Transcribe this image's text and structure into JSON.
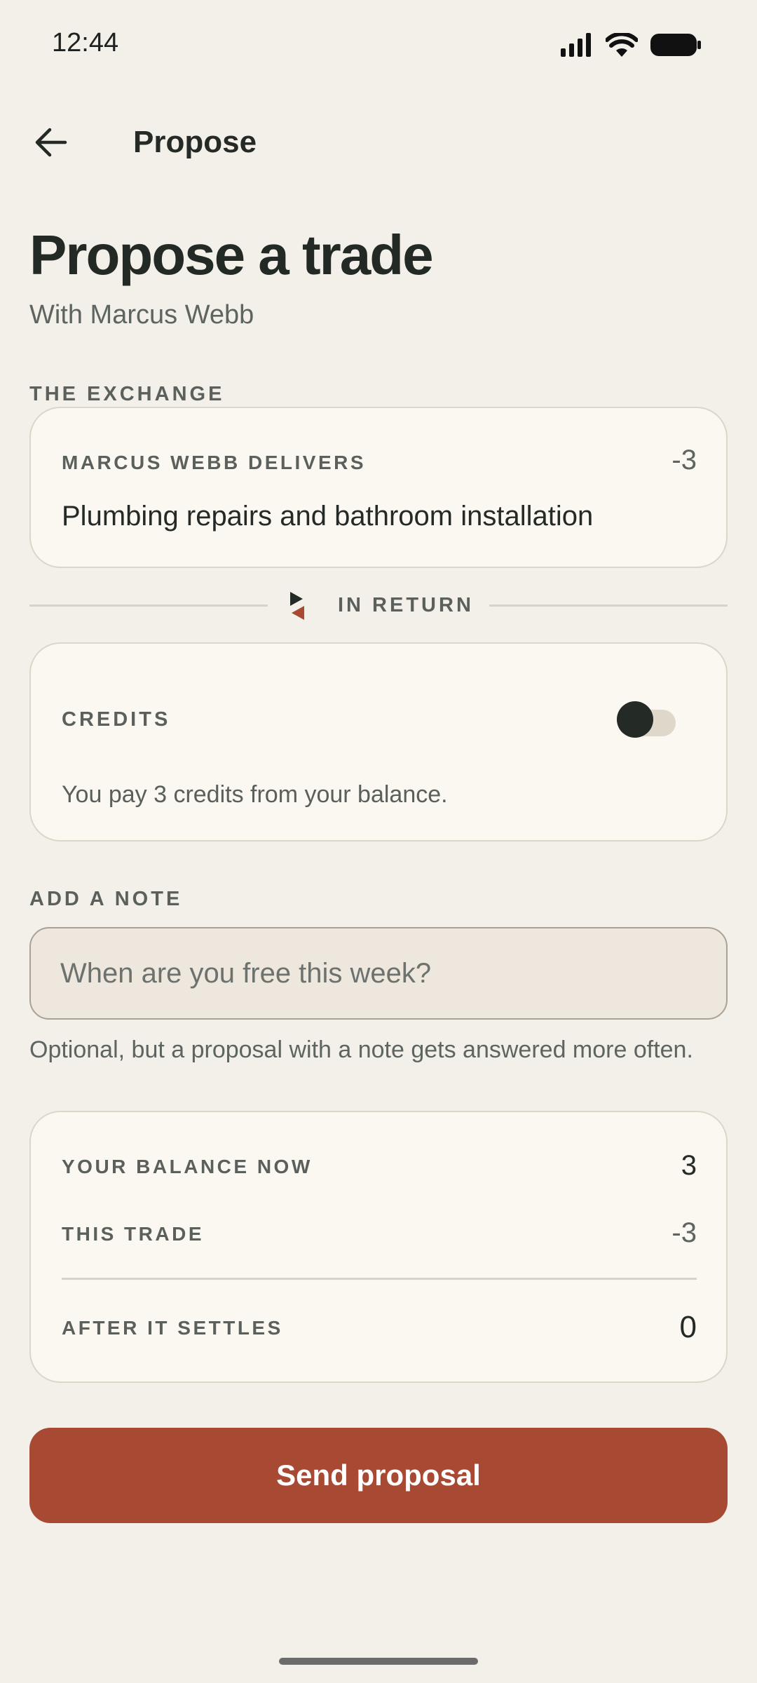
{
  "status_bar": {
    "time": "12:44"
  },
  "app_bar": {
    "title": "Propose"
  },
  "header": {
    "title": "Propose a trade",
    "subtitle": "With Marcus Webb"
  },
  "exchange": {
    "section_label": "THE EXCHANGE",
    "provider_label": "MARCUS WEBB DELIVERS",
    "amount": "-3",
    "service": "Plumbing repairs and bathroom installation"
  },
  "divider": {
    "label": "IN RETURN"
  },
  "credits": {
    "label": "CREDITS",
    "toggle_on": false,
    "description": "You pay 3 credits from your balance."
  },
  "note": {
    "label": "ADD A NOTE",
    "placeholder": "When are you free this week?",
    "value": "",
    "help": "Optional, but a proposal with a note gets answered more often."
  },
  "balance": {
    "now_label": "YOUR BALANCE NOW",
    "now_value": "3",
    "trade_label": "THIS TRADE",
    "trade_value": "-3",
    "after_label": "AFTER IT SETTLES",
    "after_value": "0"
  },
  "actions": {
    "send_label": "Send proposal"
  },
  "colors": {
    "background": "#F2F0E9",
    "card": "#FAF8F1",
    "accent": "#A84A33",
    "text": "#252A26",
    "muted": "#5E6460"
  }
}
